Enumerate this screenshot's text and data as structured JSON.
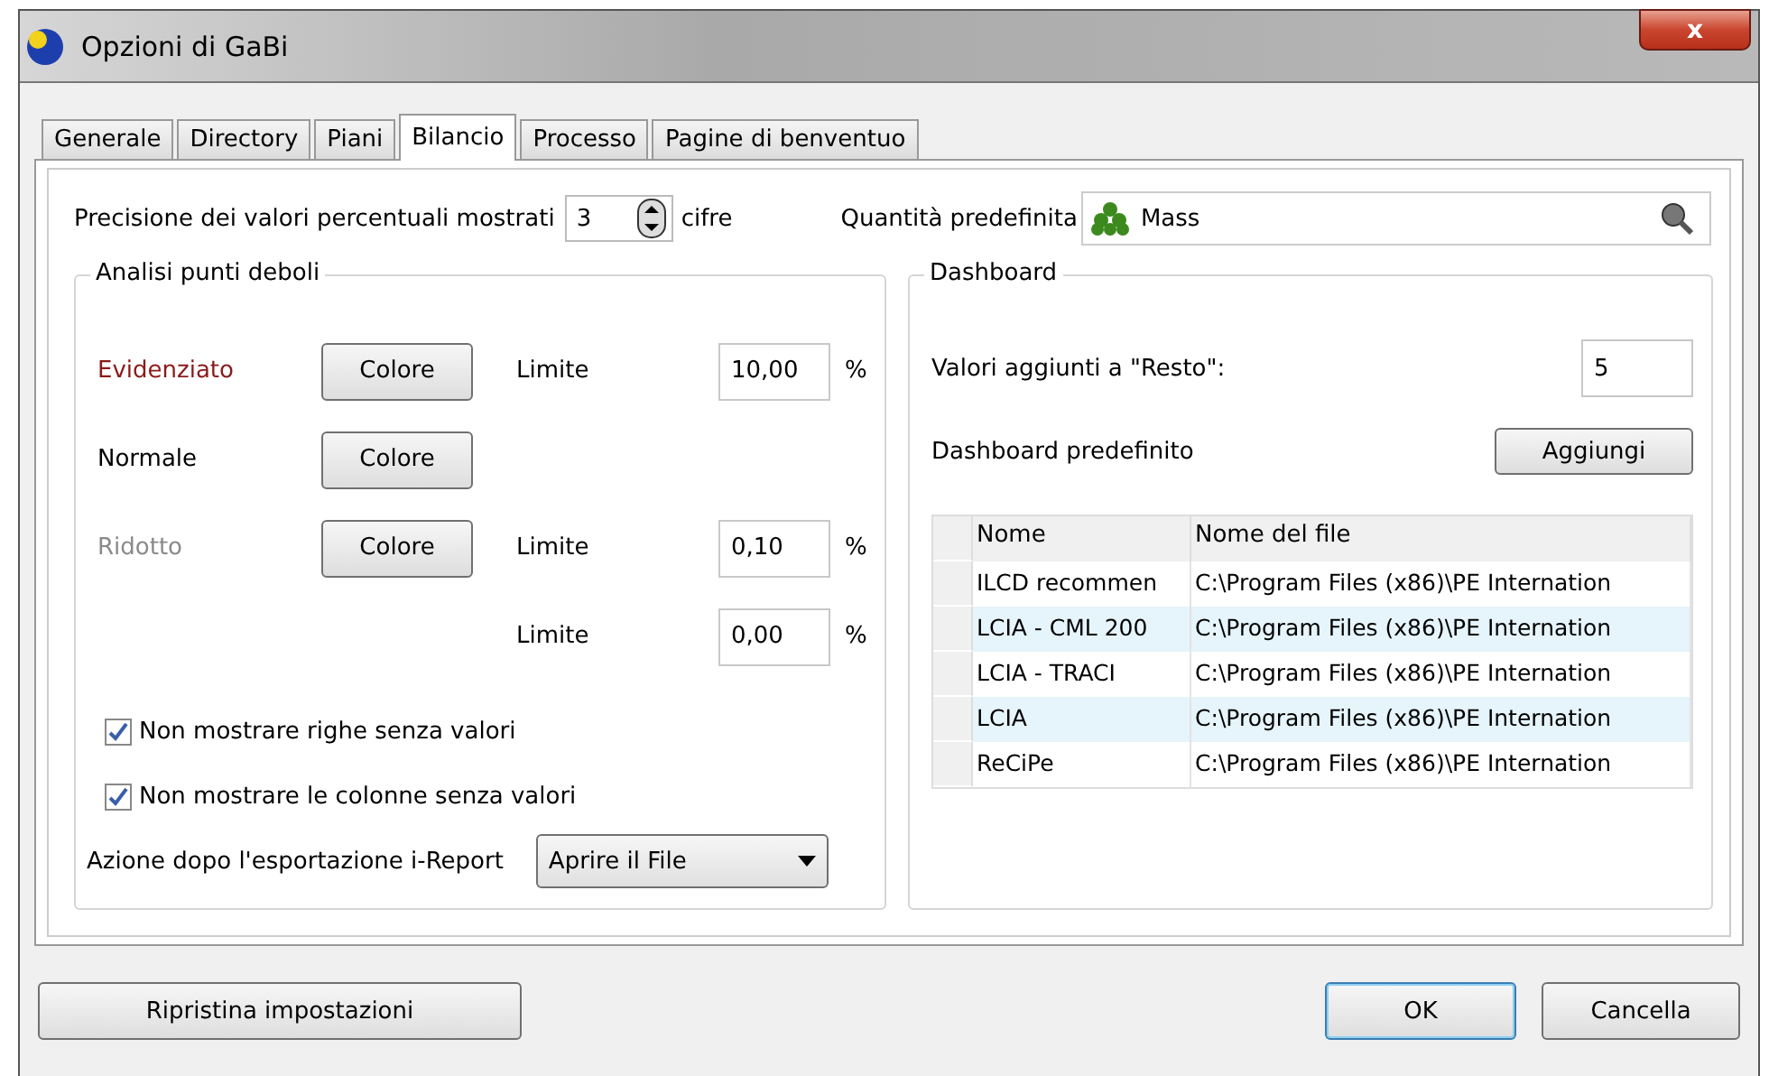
{
  "window": {
    "title": "Opzioni di GaBi",
    "close": "x"
  },
  "tabs": [
    {
      "label": "Generale",
      "selected": false
    },
    {
      "label": "Directory",
      "selected": false
    },
    {
      "label": "Piani",
      "selected": false
    },
    {
      "label": "Bilancio",
      "selected": true
    },
    {
      "label": "Processo",
      "selected": false
    },
    {
      "label": "Pagine di benventuo",
      "selected": false
    }
  ],
  "precision": {
    "label": "Precisione dei valori percentuali mostrati",
    "value": "3",
    "unit": "cifre"
  },
  "default_quantity": {
    "label": "Quantità predefinita",
    "value": "Mass"
  },
  "weak_points": {
    "title": "Analisi punti deboli",
    "rows": [
      {
        "label": "Evidenziato",
        "color": "#8b1a1a",
        "button": "Colore",
        "limit_label": "Limite",
        "value": "10,00",
        "unit": "%"
      },
      {
        "label": "Normale",
        "color": "#000000",
        "button": "Colore"
      },
      {
        "label": "Ridotto",
        "color": "#8a8a8a",
        "button": "Colore",
        "limit_label": "Limite",
        "value": "0,10",
        "unit": "%"
      },
      {
        "limit_label": "Limite",
        "value": "0,00",
        "unit": "%"
      }
    ],
    "checkboxes": [
      {
        "label": "Non mostrare righe senza valori",
        "checked": true
      },
      {
        "label": "Non mostrare le colonne senza valori",
        "checked": true
      }
    ],
    "export_action": {
      "label": "Azione dopo l'esportazione i-Report",
      "value": "Aprire il File"
    }
  },
  "dashboard": {
    "title": "Dashboard",
    "added_values": {
      "label": "Valori aggiunti a \"Resto\":",
      "value": "5"
    },
    "default_dashboard": {
      "label": "Dashboard predefinito",
      "button": "Aggiungi"
    },
    "table": {
      "columns": [
        "Nome",
        "Nome del file"
      ],
      "rows": [
        [
          "ILCD recommen",
          "C:\\Program Files (x86)\\PE Internation"
        ],
        [
          "LCIA - CML 200",
          "C:\\Program Files (x86)\\PE Internation"
        ],
        [
          "LCIA - TRACI",
          "C:\\Program Files (x86)\\PE Internation"
        ],
        [
          "LCIA",
          "C:\\Program Files (x86)\\PE Internation"
        ],
        [
          "ReCiPe",
          "C:\\Program Files (x86)\\PE Internation"
        ]
      ]
    }
  },
  "buttons": {
    "reset": "Ripristina impostazioni",
    "ok": "OK",
    "cancel": "Cancella"
  }
}
